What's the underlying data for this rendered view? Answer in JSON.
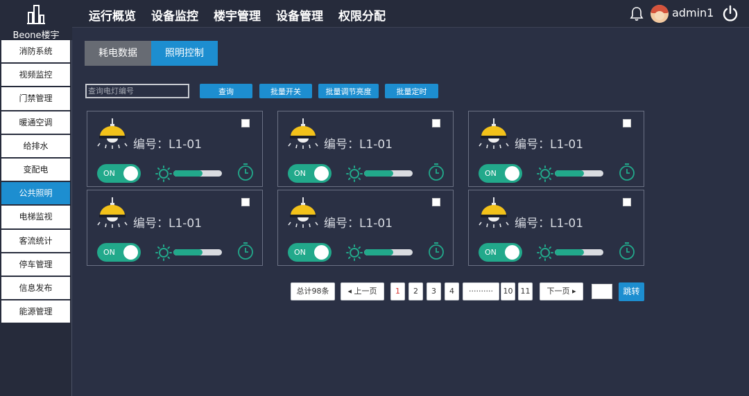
{
  "brand": {
    "name": "Beone楼宇"
  },
  "nav": [
    "运行概览",
    "设备监控",
    "楼宇管理",
    "设备管理",
    "权限分配"
  ],
  "user": {
    "name": "admin1"
  },
  "sidebar": {
    "items": [
      "消防系统",
      "视频监控",
      "门禁管理",
      "暖通空调",
      "给排水",
      "变配电",
      "公共照明",
      "电梯监视",
      "客流统计",
      "停车管理",
      "信息发布",
      "能源管理"
    ],
    "active": "公共照明"
  },
  "tabs": [
    {
      "label": "耗电数据",
      "active": false
    },
    {
      "label": "照明控制",
      "active": true
    }
  ],
  "search": {
    "placeholder": "查询电灯编号"
  },
  "actions": {
    "query": "查询",
    "batch_switch": "批量开关",
    "batch_brightness": "批量调节亮度",
    "batch_timer": "批量定时"
  },
  "lights": [
    {
      "label": "编号：L1-01",
      "switch": "ON",
      "brightness": 0.6,
      "checked": false
    },
    {
      "label": "编号：L1-01",
      "switch": "ON",
      "brightness": 0.6,
      "checked": false
    },
    {
      "label": "编号：L1-01",
      "switch": "ON",
      "brightness": 0.6,
      "checked": false
    },
    {
      "label": "编号：L1-01",
      "switch": "ON",
      "brightness": 0.6,
      "checked": false
    },
    {
      "label": "编号：L1-01",
      "switch": "ON",
      "brightness": 0.6,
      "checked": false
    },
    {
      "label": "编号：L1-01",
      "switch": "ON",
      "brightness": 0.6,
      "checked": false
    }
  ],
  "pagination": {
    "total": "总计98条",
    "prev": "上一页",
    "pages": [
      "1",
      "2",
      "3",
      "4"
    ],
    "ellipsis": "··········",
    "tail_pages": [
      "10",
      "11"
    ],
    "next": "下一页",
    "current": "1",
    "goto": "跳转"
  },
  "colors": {
    "accent": "#1d8ed0",
    "switch_on": "#22a98b",
    "lamp": "#f3c21a",
    "bg": "#2a3044"
  }
}
